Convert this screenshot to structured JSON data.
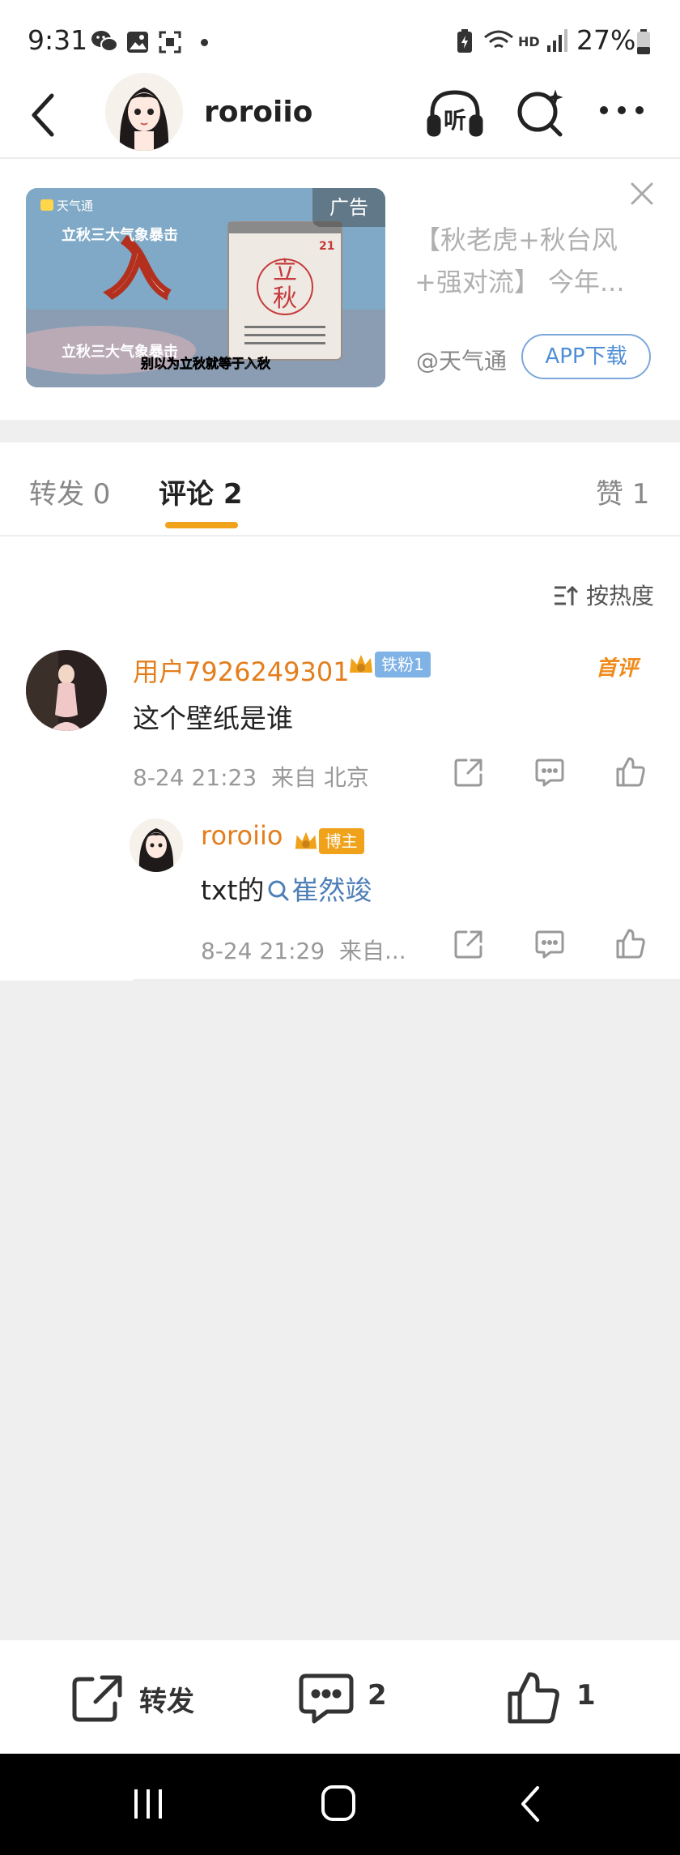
{
  "status_bar": {
    "time": "9:31",
    "battery": "27%",
    "icons": [
      "wechat-icon",
      "gallery-icon",
      "screenshot-icon",
      "dot-icon",
      "battery-saver-icon",
      "wifi-icon",
      "hd-icon",
      "signal-icon",
      "battery-icon"
    ],
    "hd_label": "HD"
  },
  "header": {
    "username": "roroiio",
    "listen_label": "听"
  },
  "ad": {
    "tag": "广告",
    "title": "【秋老虎+秋台风+强对流】 今年...",
    "source": "@天气通",
    "button": "APP下载",
    "image_text": {
      "app_badge": "天气通",
      "line": "立秋三大气象暴击",
      "big_char": "入",
      "calendar_top": "立",
      "calendar_bottom": "秋",
      "calendar_day": "21",
      "caption": "别以为立秋就等于入秋"
    }
  },
  "tabs": {
    "repost": "转发 0",
    "comments": "评论 2",
    "likes": "赞 1"
  },
  "sort_label": "按热度",
  "comments": [
    {
      "user": "用户7926249301",
      "badge": "铁粉1",
      "first_label": "首评",
      "text": "这个壁纸是谁",
      "time": "8-24 21:23",
      "location": "来自 北京"
    }
  ],
  "reply": {
    "user": "roroiio",
    "badge": "博主",
    "text_prefix": "txt的",
    "mention": "崔然竣",
    "time": "8-24 21:29",
    "location": "来自..."
  },
  "toolbar": {
    "repost": "转发",
    "comments": "2",
    "likes": "1"
  },
  "colors": {
    "accent_orange": "#f0a21a",
    "username_orange": "#e47e1c",
    "link_blue": "#4f8ed6"
  }
}
